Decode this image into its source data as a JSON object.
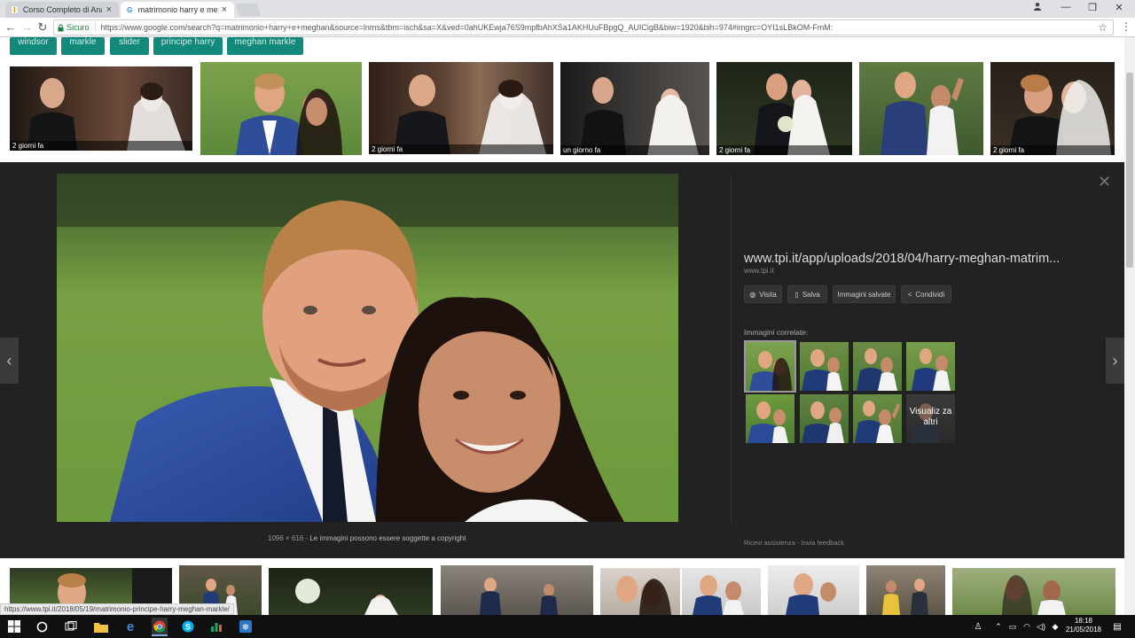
{
  "tabs": [
    {
      "title": "Corso Completo di Anali",
      "icon": "doc-icon"
    },
    {
      "title": "matrimonio harry e megh",
      "icon": "google-icon"
    }
  ],
  "window": {
    "minimize": "—",
    "restore": "❐",
    "close": "✕"
  },
  "address": {
    "secure_label": "Sicuro",
    "url": "https://www.google.com/search?q=matrimonio+harry+e+meghan&source=lnms&tbm=isch&sa=X&ved=0ahUKEwja76S9mpfbAhXSa1AKHUuFBpgQ_AUICigB&biw=1920&bih=974#imgrc=OYI1sLBkOM-FmM:"
  },
  "chips": [
    "windsor",
    "markle",
    "slider",
    "principe harry",
    "meghan markle"
  ],
  "top_thumbnails": [
    {
      "caption": "2 giorni fa"
    },
    {
      "caption": ""
    },
    {
      "caption": "2 giorni fa"
    },
    {
      "caption": "un giorno fa"
    },
    {
      "caption": "2 giorni fa"
    },
    {
      "caption": ""
    },
    {
      "caption": "2 giorni fa"
    }
  ],
  "viewer": {
    "dimensions": "1096 × 616",
    "copyright": "Le immagini possono essere soggette a copyright",
    "source_url": "www.tpi.it/app/uploads/2018/04/harry-meghan-matrim...",
    "source_domain": "www.tpi.it",
    "actions": [
      {
        "label": "Visita",
        "icon": "globe-icon"
      },
      {
        "label": "Salva",
        "icon": "bookmark-icon"
      },
      {
        "label": "Immagini salvate",
        "icon": ""
      },
      {
        "label": "Condividi",
        "icon": "share-icon"
      }
    ],
    "related_heading": "Immagini correlate:",
    "more_label": "Visualiz za altri",
    "footer_help": "Ricevi assistenza",
    "footer_feedback": "Invia feedback"
  },
  "status_url": "https://www.tpi.it/2018/05/19/matrimonio-principe-harry-meghan-markle/",
  "taskbar": {
    "time": "18:18",
    "date": "21/05/2018"
  },
  "colors": {
    "chip": "#12897b",
    "viewer_bg": "#222222",
    "taskbar": "#101010"
  }
}
